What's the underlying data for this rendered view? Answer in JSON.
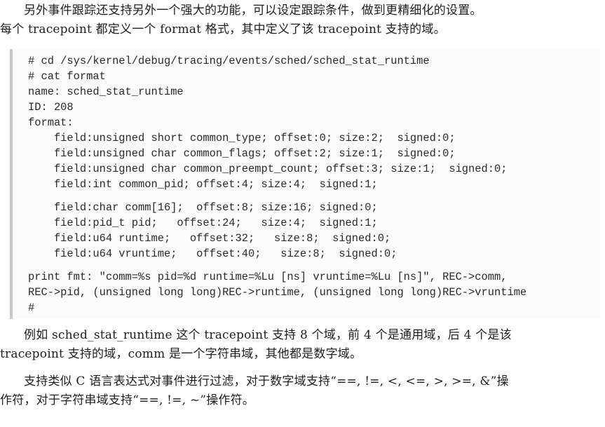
{
  "intro": {
    "line1": "另外事件跟踪还支持另外一个强大的功能，可以设定跟踪条件，做到更精细化的设置。",
    "line2": "每个 tracepoint 都定义一个 format 格式，其中定义了该 tracepoint 支持的域。"
  },
  "code": {
    "header_lines": [
      "# cd /sys/kernel/debug/tracing/events/sched/sched_stat_runtime",
      "# cat format",
      "name: sched_stat_runtime",
      "ID: 208",
      "format:"
    ],
    "common_fields": [
      "    field:unsigned short common_type; offset:0; size:2;  signed:0;",
      "    field:unsigned char common_flags; offset:2; size:1;  signed:0;",
      "    field:unsigned char common_preempt_count; offset:3; size:1;  signed:0;",
      "    field:int common_pid; offset:4; size:4;  signed:1;"
    ],
    "event_fields": [
      "    field:char comm[16];  offset:8; size:16; signed:0;",
      "    field:pid_t pid;   offset:24;   size:4;  signed:1;",
      "    field:u64 runtime;   offset:32;   size:8;  signed:0;",
      "    field:u64 vruntime;   offset:40;   size:8;  signed:0;"
    ],
    "print_lines": [
      "print fmt: \"comm=%s pid=%d runtime=%Lu [ns] vruntime=%Lu [ns]\", REC->comm,",
      "REC->pid, (unsigned long long)REC->runtime, (unsigned long long)REC->vruntime",
      "#"
    ]
  },
  "para2": {
    "line1": "例如 sched_stat_runtime 这个 tracepoint 支持 8 个域，前 4 个是通用域，后 4 个是该",
    "line2": "tracepoint 支持的域，comm 是一个字符串域，其他都是数字域。"
  },
  "para3": {
    "line1": "支持类似 C 语言表达式对事件进行过滤，对于数字域支持“==, !=, <, <=, >, >=, &”操",
    "line2": "作符，对于字符串域支持“==, !=, ~”操作符。"
  }
}
